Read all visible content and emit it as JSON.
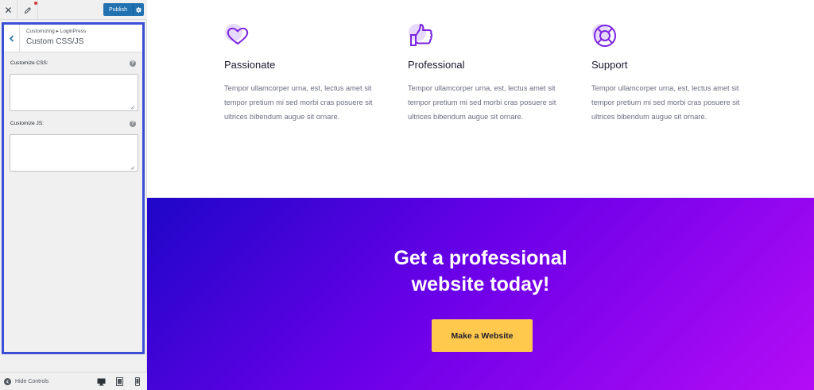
{
  "toolbar": {
    "close_icon": "close-icon",
    "customize_icon": "pencil-icon",
    "publish_label": "Publish",
    "settings_icon": "gear-icon",
    "unsaved_dot_color": "#d63638",
    "publish_color": "#2271b1"
  },
  "panel": {
    "breadcrumb": "Customizing ▸ LoginPress",
    "title": "Custom CSS/JS",
    "back_icon": "chevron-left-icon",
    "accent_border_color": "#3a4fd4",
    "fields": [
      {
        "label": "Customize CSS:",
        "value": "",
        "help_icon": "question-icon"
      },
      {
        "label": "Customize JS:",
        "value": "",
        "help_icon": "question-icon"
      }
    ]
  },
  "footer": {
    "hide_controls_label": "Hide Controls",
    "devices": [
      "desktop-icon",
      "tablet-icon",
      "mobile-icon"
    ]
  },
  "preview": {
    "features": [
      {
        "title": "Passionate",
        "icon": "heart-icon",
        "text": "Tempor ullamcorper urna, est, lectus amet sit tempor pretium mi sed morbi cras posuere sit ultrices bibendum augue sit ornare."
      },
      {
        "title": "Professional",
        "icon": "thumbs-up-icon",
        "text": "Tempor ullamcorper urna, est, lectus amet sit tempor pretium mi sed morbi cras posuere sit ultrices bibendum augue sit ornare."
      },
      {
        "title": "Support",
        "icon": "lifebuoy-icon",
        "text": "Tempor ullamcorper urna, est, lectus amet sit tempor pretium mi sed morbi cras posuere sit ultrices bibendum augue sit ornare."
      }
    ],
    "cta": {
      "heading_line1": "Get a professional",
      "heading_line2": "website today!",
      "button_label": "Make a Website",
      "button_color": "#ffc94d",
      "gradient_start": "#1e07c8",
      "gradient_end": "#b40cf6"
    }
  }
}
